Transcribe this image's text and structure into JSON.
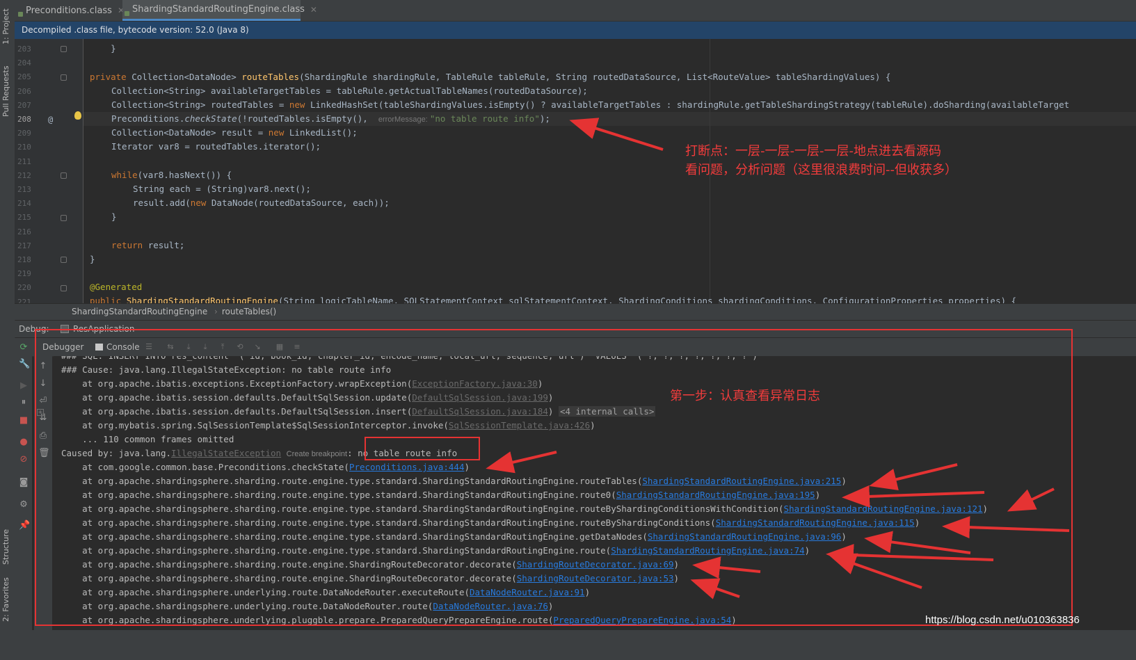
{
  "left_strip": {
    "project_label": "1: Project",
    "pull_label": "Pull Requests",
    "structure_label": "Structure",
    "favorites_label": "2: Favorites"
  },
  "tabs": [
    {
      "label": "Preconditions.class",
      "active": false
    },
    {
      "label": "ShardingStandardRoutingEngine.class",
      "active": true
    }
  ],
  "banner": {
    "text": "Decompiled .class file, bytecode version: 52.0 (Java 8)"
  },
  "editor": {
    "line_numbers": [
      "203",
      "204",
      "205",
      "206",
      "207",
      "208",
      "209",
      "210",
      "211",
      "212",
      "213",
      "214",
      "215",
      "216",
      "217",
      "218",
      "219",
      "220",
      "221"
    ],
    "current_line": "208",
    "at_marker": "@",
    "lines": {
      "l203": "    }",
      "l205_kw": "private ",
      "l205_a": "Collection<DataNode> ",
      "l205_fn": "routeTables",
      "l205_b": "(ShardingRule shardingRule, TableRule tableRule, String routedDataSource, List<RouteValue> tableShardingValues) {",
      "l206": "Collection<String> availableTargetTables = tableRule.getActualTableNames(routedDataSource);",
      "l207_a": "Collection<String> routedTables = ",
      "l207_kw": "new ",
      "l207_b": "LinkedHashSet(tableShardingValues.isEmpty() ? availableTargetTables : shardingRule.getTableShardingStrategy(tableRule).doSharding(availableTarget",
      "l208_a": "Preconditions.",
      "l208_it": "checkState",
      "l208_b": "(!routedTables.isEmpty(),  ",
      "l208_hint": "errorMessage: ",
      "l208_str": "\"no table route info\"",
      "l208_c": ");",
      "l209_a": "Collection<DataNode> result = ",
      "l209_kw": "new ",
      "l209_b": "LinkedList();",
      "l210": "Iterator var8 = routedTables.iterator();",
      "l212_kw": "while",
      "l212_b": "(var8.hasNext()) {",
      "l213": "String each = (String)var8.next();",
      "l214_a": "result.add(",
      "l214_kw": "new ",
      "l214_b": "DataNode(routedDataSource, each));",
      "l215": "}",
      "l217_kw": "return ",
      "l217_b": "result;",
      "l218": "}",
      "l220": "@Generated",
      "l221_kw": "public ",
      "l221_fn": "ShardingStandardRoutingEngine",
      "l221_b": "(String logicTableName, SQLStatementContext sqlStatementContext, ShardingConditions shardingConditions, ConfigurationProperties properties) {"
    }
  },
  "breadcrumb": {
    "class_name": "ShardingStandardRoutingEngine",
    "sep": "›",
    "method": "routeTables()"
  },
  "debug": {
    "label": "Debug:",
    "session": "ResApplication",
    "tab_debugger": "Debugger",
    "tab_console": "Console"
  },
  "console": {
    "l0": "### SQL: INSERT INTO res_content  ( id, book_id, chapter_id, encode_name, local_url, sequence, url )  VALUES  ( ?, ?, ?, ?, ?, ?, ? )",
    "l1": "### Cause: java.lang.IllegalStateException: no table route info",
    "l2_a": "    at org.apache.ibatis.exceptions.ExceptionFactory.wrapException(",
    "l2_link": "ExceptionFactory.java:30",
    "l3_a": "    at org.apache.ibatis.session.defaults.DefaultSqlSession.update(",
    "l3_link": "DefaultSqlSession.java:199",
    "l4_a": "    at org.apache.ibatis.session.defaults.DefaultSqlSession.insert(",
    "l4_link": "DefaultSqlSession.java:184",
    "l4_internal": "<4 internal calls>",
    "l5_a": "    at org.mybatis.spring.SqlSessionTemplate$SqlSessionInterceptor.invoke(",
    "l5_link": "SqlSessionTemplate.java:426",
    "l6": "    ... 110 common frames omitted",
    "l7_a": "Caused by: java.lang.",
    "l7_link": "IllegalStateException",
    "l7_hint": "Create breakpoint",
    "l7_b": ": no table route info",
    "l8_a": "    at com.google.common.base.Preconditions.checkState(",
    "l8_link": "Preconditions.java:444",
    "l9_a": "    at org.apache.shardingsphere.sharding.route.engine.type.standard.ShardingStandardRoutingEngine.routeTables(",
    "l9_link": "ShardingStandardRoutingEngine.java:215",
    "l10_a": "    at org.apache.shardingsphere.sharding.route.engine.type.standard.ShardingStandardRoutingEngine.route0(",
    "l10_link": "ShardingStandardRoutingEngine.java:195",
    "l11_a": "    at org.apache.shardingsphere.sharding.route.engine.type.standard.ShardingStandardRoutingEngine.routeByShardingConditionsWithCondition(",
    "l11_link": "ShardingStandardRoutingEngine.java:121",
    "l12_a": "    at org.apache.shardingsphere.sharding.route.engine.type.standard.ShardingStandardRoutingEngine.routeByShardingConditions(",
    "l12_link": "ShardingStandardRoutingEngine.java:115",
    "l13_a": "    at org.apache.shardingsphere.sharding.route.engine.type.standard.ShardingStandardRoutingEngine.getDataNodes(",
    "l13_link": "ShardingStandardRoutingEngine.java:96",
    "l14_a": "    at org.apache.shardingsphere.sharding.route.engine.type.standard.ShardingStandardRoutingEngine.route(",
    "l14_link": "ShardingStandardRoutingEngine.java:74",
    "l15_a": "    at org.apache.shardingsphere.sharding.route.engine.ShardingRouteDecorator.decorate(",
    "l15_link": "ShardingRouteDecorator.java:69",
    "l16_a": "    at org.apache.shardingsphere.sharding.route.engine.ShardingRouteDecorator.decorate(",
    "l16_link": "ShardingRouteDecorator.java:53",
    "l17_a": "    at org.apache.shardingsphere.underlying.route.DataNodeRouter.executeRoute(",
    "l17_link": "DataNodeRouter.java:91",
    "l18_a": "    at org.apache.shardingsphere.underlying.route.DataNodeRouter.route(",
    "l18_link": "DataNodeRouter.java:76",
    "l19_a": "    at org.apache.shardingsphere.underlying.pluggble.prepare.PreparedQueryPrepareEngine.route(",
    "l19_link": "PreparedQueryPrepareEngine.java:54",
    "close": ")"
  },
  "annotations": {
    "note1_line1": "打断点：一层-一层-一层-一层-地点进去看源码",
    "note1_line2": "看问题，分析问题（这里很浪费时间--但收获多）",
    "note2": "第一步：认真查看异常日志",
    "color": "#e53333"
  },
  "watermark": "https://blog.csdn.net/u010363836"
}
